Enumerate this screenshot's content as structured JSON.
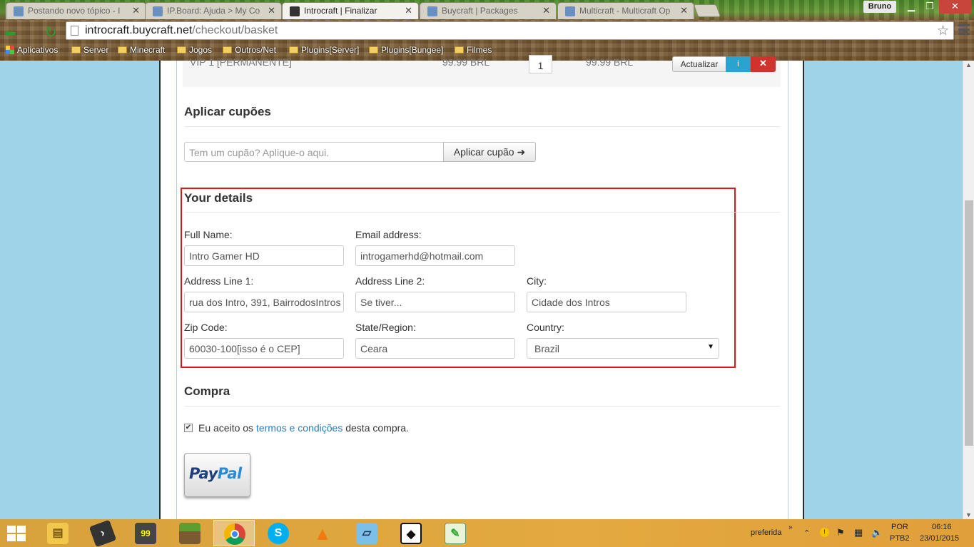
{
  "browser": {
    "tabs": [
      {
        "title": "Postando novo tópico - I",
        "active": false
      },
      {
        "title": "IP.Board: Ajuda > My Co",
        "active": false
      },
      {
        "title": "Introcraft | Finalizar",
        "active": true
      },
      {
        "title": "Buycraft | Packages",
        "active": false
      },
      {
        "title": "Multicraft - Multicraft Op",
        "active": false
      }
    ],
    "user": "Bruno",
    "url_host": "introcraft.buycraft.net",
    "url_path": "/checkout/basket",
    "bookmarks": [
      "Aplicativos",
      "Server",
      "Minecraft",
      "Jogos",
      "Outros/Net",
      "Plugins[Server]",
      "Plugins[Bungee]",
      "Filmes"
    ]
  },
  "basket": {
    "item": "VIP 1 [PERMANENTE]",
    "price": "99.99 BRL",
    "quantity": "1",
    "total": "99.99 BRL",
    "update_label": "Actualizar",
    "info_label": "i",
    "remove_label": "✕"
  },
  "coupon": {
    "title": "Aplicar cupões",
    "placeholder": "Tem um cupão? Aplique-o aqui.",
    "button": "Aplicar cupão ➜"
  },
  "details": {
    "title": "Your details",
    "full_name": {
      "label": "Full Name:",
      "value": "Intro Gamer HD"
    },
    "email": {
      "label": "Email address:",
      "value": "introgamerhd@hotmail.com"
    },
    "address1": {
      "label": "Address Line 1:",
      "value": "rua dos Intro, 391, BairrodosIntros"
    },
    "address2": {
      "label": "Address Line 2:",
      "value": "Se tiver..."
    },
    "city": {
      "label": "City:",
      "value": "Cidade dos Intros"
    },
    "zip": {
      "label": "Zip Code:",
      "value": "60030-100[isso é o CEP]"
    },
    "state": {
      "label": "State/Region:",
      "value": "Ceara"
    },
    "country": {
      "label": "Country:",
      "value": "Brazil"
    }
  },
  "purchase": {
    "title": "Compra",
    "terms_before": "Eu aceito os ",
    "terms_link": "termos e condições",
    "terms_after": " desta compra.",
    "accepted": true,
    "paypal_1": "Pay",
    "paypal_2": "Pal"
  },
  "taskbar": {
    "tray_label": "preferida",
    "lang": "POR",
    "layout": "PTB2",
    "time": "06:16",
    "date": "23/01/2015",
    "apps": [
      "file-explorer",
      "terminal",
      "performance-monitor",
      "minecraft",
      "chrome",
      "skype",
      "vlc",
      "notepad",
      "app-launcher",
      "notepad-plus-plus"
    ]
  },
  "colors": {
    "accent_red": "#e0161b",
    "link": "#2a7ab8",
    "info": "#2aa4cf",
    "danger": "#d2322d"
  }
}
